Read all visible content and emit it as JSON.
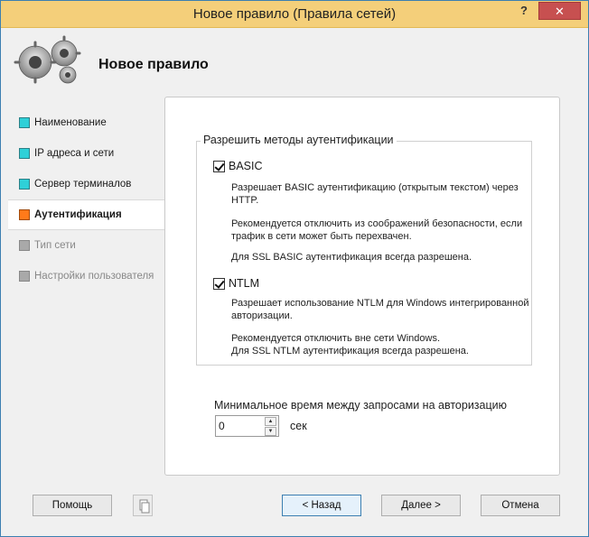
{
  "window": {
    "title": "Новое правило (Правила сетей)",
    "help_glyph": "?",
    "close_glyph": "✕"
  },
  "header": {
    "title": "Новое правило",
    "icon": "gears-icon"
  },
  "nav": {
    "items": [
      {
        "label": "Наименование",
        "state": "done"
      },
      {
        "label": "IP адреса и сети",
        "state": "done"
      },
      {
        "label": "Сервер терминалов",
        "state": "done"
      },
      {
        "label": "Аутентификация",
        "state": "active"
      },
      {
        "label": "Тип сети",
        "state": "disabled"
      },
      {
        "label": "Настройки пользователя",
        "state": "disabled"
      }
    ]
  },
  "auth": {
    "group_title": "Разрешить методы аутентификации",
    "basic": {
      "label": "BASIC",
      "checked": true,
      "desc1": "Разрешает BASIC аутентификацию (открытым текстом) через HTTP.",
      "desc2": "Рекомендуется отключить из соображений безопасности, если трафик в сети может быть перехвачен.",
      "desc3": "Для SSL BASIC аутентификация всегда разрешена."
    },
    "ntlm": {
      "label": "NTLM",
      "checked": true,
      "desc1": "Разрешает использование NTLM  для Windows интегрированной авторизации.",
      "desc2": "Рекомендуется отключить вне сети Windows.",
      "desc3": "Для SSL NTLM аутентификация всегда разрешена."
    }
  },
  "interval": {
    "label": "Минимальное время между запросами на авторизацию",
    "value": "0",
    "unit": "сек"
  },
  "buttons": {
    "help": "Помощь",
    "back": "< Назад",
    "next": "Далее >",
    "cancel": "Отмена"
  },
  "colors": {
    "title_bar": "#f4cf7a",
    "close": "#c75050",
    "done": "#2fd0d8",
    "active": "#ff7a1a",
    "disabled": "#a9a9a9"
  }
}
